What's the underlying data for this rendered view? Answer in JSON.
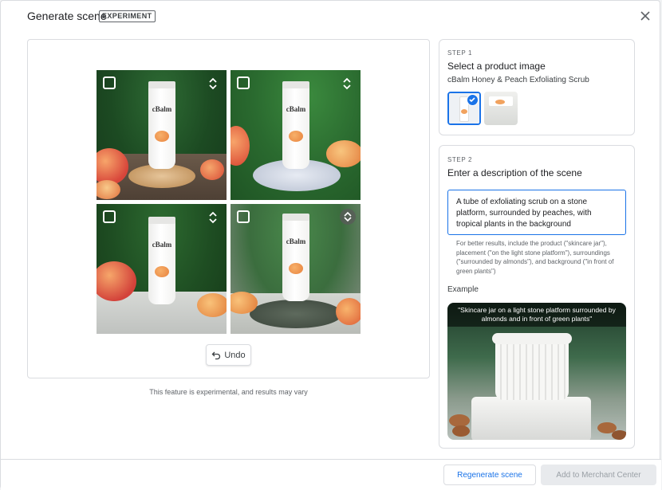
{
  "header": {
    "title": "Generate scene",
    "badge": "EXPERIMENT"
  },
  "preview": {
    "tiles": [
      {
        "brand": "cBalm",
        "expand_icon": "unfold-icon"
      },
      {
        "brand": "cBalm",
        "expand_icon": "unfold-icon"
      },
      {
        "brand": "cBalm",
        "expand_icon": "unfold-icon"
      },
      {
        "brand": "cBalm",
        "expand_icon": "unfold-circle-icon"
      }
    ],
    "undo_label": "Undo",
    "footnote": "This feature is experimental, and results may vary"
  },
  "step1": {
    "label": "STEP 1",
    "title": "Select a product image",
    "product_name": "cBalm Honey & Peach Exfoliating Scrub"
  },
  "step2": {
    "label": "STEP 2",
    "title": "Enter a description of the scene",
    "description": "A tube of exfoliating scrub on a stone platform, surrounded by peaches, with tropical plants in the background",
    "hint": "For better results, include the product (\"skincare jar\"), placement (\"on the light stone platform\"), surroundings (\"surrounded by almonds\"), and background (\"in front of green plants\")",
    "example_label": "Example",
    "example_caption": "\"Skincare jar on a light stone platform surrounded by almonds and in front of green plants\""
  },
  "footer": {
    "regenerate_label": "Regenerate scene",
    "add_label": "Add to Merchant Center"
  },
  "colors": {
    "accent": "#1a73e8",
    "border": "#dadce0",
    "disabled_bg": "#e8eaed"
  }
}
